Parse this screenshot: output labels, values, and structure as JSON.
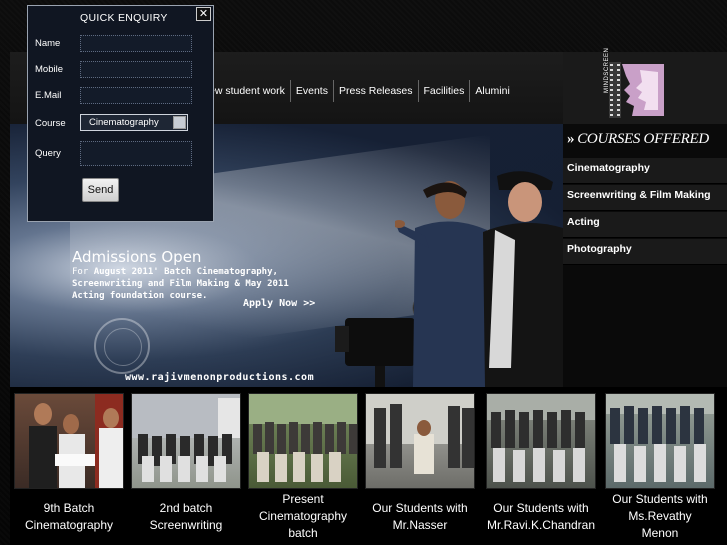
{
  "enquiry": {
    "title": "QUICK ENQUIRY",
    "close": "✕",
    "fields": {
      "name_label": "Name",
      "mobile_label": "Mobile",
      "email_label": "E.Mail",
      "course_label": "Course",
      "course_value": "Cinematography",
      "query_label": "Query"
    },
    "send_label": "Send"
  },
  "nav": {
    "items": [
      "ew student work",
      "Events",
      "Press  Releases",
      "Facilities",
      "Alumini"
    ]
  },
  "logo": {
    "word": "MINDSCREEN"
  },
  "hero": {
    "admissions_title": "Admissions Open",
    "line1_for": "For ",
    "line1": "August 2011' Batch Cinematography,",
    "line2": "Screenwriting and Film Making & May 2011",
    "line3": "Acting foundation course.",
    "apply": "Apply Now >>",
    "website": "www.rajivmenonproductions.com"
  },
  "courses": {
    "arrows": "»",
    "header": "COURSES OFFERED",
    "items": [
      "Cinematography",
      "Screenwriting & Film Making",
      "Acting",
      "Photography"
    ]
  },
  "thumbs": [
    {
      "line1": "9th Batch",
      "line2": "Cinematography",
      "line3": ""
    },
    {
      "line1": "2nd batch",
      "line2": "Screenwriting",
      "line3": ""
    },
    {
      "line1": "Present",
      "line2": "Cinematography",
      "line3": "batch"
    },
    {
      "line1": "Our Students with",
      "line2": "Mr.Nasser",
      "line3": ""
    },
    {
      "line1": "Our Students with",
      "line2": "Mr.Ravi.K.Chandran",
      "line3": ""
    },
    {
      "line1": "Our Students with",
      "line2": "Ms.Revathy",
      "line3": "Menon"
    }
  ],
  "colors": {
    "panel": "#101622",
    "sidebar_item": "#1a1a1a",
    "logo_accent": "#c9a0c8"
  }
}
